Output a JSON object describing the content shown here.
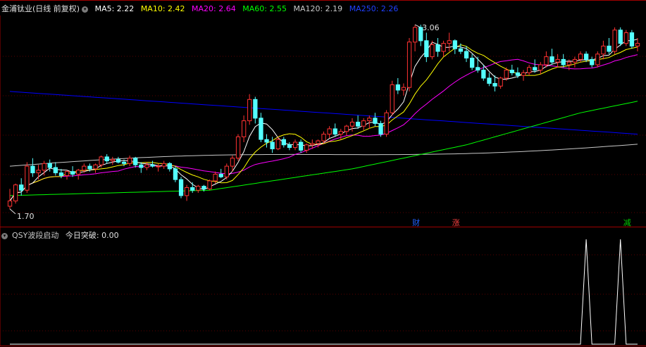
{
  "colors": {
    "up": "#ff3232",
    "down": "#54ffff",
    "ma5": "#ffffff",
    "ma10": "#ffff00",
    "ma20": "#ff00ff",
    "ma60": "#00ff00",
    "ma120": "#c8c8c8",
    "ma250": "#0000ff",
    "grid": "#a00000",
    "tag_cai": "#2060ff",
    "tag_zhang": "#ff4040",
    "tag_jian": "#00cc00"
  },
  "header": {
    "stock": "金浦钛业(日线 前复权)",
    "toggle_icon": "▾",
    "ma": [
      {
        "label": "MA5: 2.22",
        "color": "#ffffff"
      },
      {
        "label": "MA10: 2.42",
        "color": "#ffff00"
      },
      {
        "label": "MA20: 2.64",
        "color": "#ff00ff"
      },
      {
        "label": "MA60: 2.55",
        "color": "#00ff00"
      },
      {
        "label": "MA120: 2.19",
        "color": "#c8c8c8"
      },
      {
        "label": "MA250: 2.26",
        "color": "#0000ff"
      }
    ]
  },
  "indicator_header": {
    "name": "QSY波段启动",
    "value_label": "今日突破: 0.00"
  },
  "markers": {
    "low": "1.70",
    "high": "3.06"
  },
  "tags": [
    {
      "label": "财",
      "index": 71,
      "color_key": "tag_cai"
    },
    {
      "label": "涨",
      "index": 78,
      "color_key": "tag_zhang"
    },
    {
      "label": "减",
      "index": 108,
      "color_key": "tag_jian"
    }
  ],
  "chart_data": {
    "type": "candlestick",
    "price_ylim": [
      1.62,
      3.17
    ],
    "candles": [
      [
        1.72,
        1.85,
        1.7,
        1.76
      ],
      [
        1.76,
        1.89,
        1.74,
        1.88
      ],
      [
        1.88,
        1.93,
        1.8,
        1.84
      ],
      [
        1.84,
        2.05,
        1.82,
        2.02
      ],
      [
        2.02,
        2.08,
        1.94,
        1.97
      ],
      [
        1.97,
        2.03,
        1.92,
        1.99
      ],
      [
        1.99,
        2.06,
        1.95,
        2.04
      ],
      [
        2.04,
        2.07,
        1.98,
        2.01
      ],
      [
        2.01,
        2.05,
        1.95,
        1.97
      ],
      [
        1.97,
        2.0,
        1.93,
        1.95
      ],
      [
        1.95,
        1.99,
        1.92,
        1.98
      ],
      [
        1.98,
        2.02,
        1.94,
        1.96
      ],
      [
        1.96,
        2.0,
        1.92,
        1.99
      ],
      [
        1.99,
        2.04,
        1.97,
        2.02
      ],
      [
        2.02,
        2.04,
        1.98,
        2.0
      ],
      [
        2.0,
        2.04,
        1.97,
        2.03
      ],
      [
        2.03,
        2.1,
        2.01,
        2.09
      ],
      [
        2.09,
        2.11,
        2.04,
        2.06
      ],
      [
        2.06,
        2.09,
        2.03,
        2.07
      ],
      [
        2.07,
        2.09,
        2.04,
        2.05
      ],
      [
        2.05,
        2.07,
        2.02,
        2.04
      ],
      [
        2.04,
        2.1,
        2.02,
        2.08
      ],
      [
        2.08,
        2.09,
        2.01,
        2.03
      ],
      [
        2.03,
        2.05,
        1.97,
        2.01
      ],
      [
        2.01,
        2.05,
        1.99,
        2.03
      ],
      [
        2.03,
        2.06,
        2.01,
        2.02
      ],
      [
        2.02,
        2.04,
        1.98,
        2.02
      ],
      [
        2.02,
        2.06,
        2.0,
        2.04
      ],
      [
        2.04,
        2.05,
        1.98,
        2.0
      ],
      [
        2.0,
        2.02,
        1.9,
        1.92
      ],
      [
        1.92,
        1.94,
        1.78,
        1.8
      ],
      [
        1.8,
        1.88,
        1.76,
        1.86
      ],
      [
        1.86,
        1.9,
        1.82,
        1.84
      ],
      [
        1.84,
        1.88,
        1.82,
        1.87
      ],
      [
        1.87,
        1.88,
        1.83,
        1.85
      ],
      [
        1.85,
        1.92,
        1.84,
        1.91
      ],
      [
        1.91,
        1.98,
        1.89,
        1.96
      ],
      [
        1.96,
        2.0,
        1.93,
        1.94
      ],
      [
        1.94,
        2.04,
        1.92,
        2.02
      ],
      [
        2.02,
        2.1,
        1.98,
        2.08
      ],
      [
        2.08,
        2.26,
        2.06,
        2.24
      ],
      [
        2.24,
        2.4,
        2.2,
        2.36
      ],
      [
        2.36,
        2.56,
        2.33,
        2.52
      ],
      [
        2.52,
        2.54,
        2.34,
        2.38
      ],
      [
        2.38,
        2.42,
        2.2,
        2.22
      ],
      [
        2.22,
        2.26,
        2.16,
        2.2
      ],
      [
        2.2,
        2.24,
        2.12,
        2.15
      ],
      [
        2.15,
        2.24,
        2.14,
        2.22
      ],
      [
        2.22,
        2.24,
        2.16,
        2.18
      ],
      [
        2.18,
        2.2,
        2.14,
        2.16
      ],
      [
        2.16,
        2.22,
        2.14,
        2.2
      ],
      [
        2.2,
        2.22,
        2.12,
        2.14
      ],
      [
        2.14,
        2.19,
        2.12,
        2.18
      ],
      [
        2.18,
        2.22,
        2.15,
        2.19
      ],
      [
        2.19,
        2.22,
        2.16,
        2.21
      ],
      [
        2.21,
        2.28,
        2.19,
        2.26
      ],
      [
        2.26,
        2.32,
        2.23,
        2.3
      ],
      [
        2.3,
        2.34,
        2.24,
        2.26
      ],
      [
        2.26,
        2.3,
        2.22,
        2.28
      ],
      [
        2.28,
        2.33,
        2.25,
        2.32
      ],
      [
        2.32,
        2.38,
        2.28,
        2.35
      ],
      [
        2.35,
        2.4,
        2.3,
        2.32
      ],
      [
        2.32,
        2.38,
        2.29,
        2.36
      ],
      [
        2.36,
        2.4,
        2.3,
        2.38
      ],
      [
        2.38,
        2.42,
        2.32,
        2.34
      ],
      [
        2.34,
        2.36,
        2.24,
        2.26
      ],
      [
        2.26,
        2.44,
        2.24,
        2.42
      ],
      [
        2.42,
        2.66,
        2.4,
        2.63
      ],
      [
        2.63,
        2.68,
        2.56,
        2.59
      ],
      [
        2.59,
        2.64,
        2.55,
        2.61
      ],
      [
        2.61,
        2.98,
        2.58,
        2.95
      ],
      [
        2.95,
        3.08,
        2.88,
        3.06
      ],
      [
        3.06,
        3.08,
        2.92,
        2.96
      ],
      [
        2.96,
        3.02,
        2.8,
        2.84
      ],
      [
        2.84,
        2.96,
        2.82,
        2.93
      ],
      [
        2.93,
        2.98,
        2.84,
        2.88
      ],
      [
        2.88,
        2.96,
        2.84,
        2.94
      ],
      [
        2.94,
        3.02,
        2.88,
        2.96
      ],
      [
        2.96,
        2.97,
        2.86,
        2.9
      ],
      [
        2.9,
        2.94,
        2.86,
        2.88
      ],
      [
        2.88,
        2.92,
        2.8,
        2.83
      ],
      [
        2.83,
        2.86,
        2.74,
        2.76
      ],
      [
        2.76,
        2.84,
        2.72,
        2.74
      ],
      [
        2.74,
        2.78,
        2.66,
        2.68
      ],
      [
        2.68,
        2.72,
        2.62,
        2.64
      ],
      [
        2.64,
        2.7,
        2.58,
        2.62
      ],
      [
        2.62,
        2.69,
        2.6,
        2.68
      ],
      [
        2.68,
        2.76,
        2.66,
        2.74
      ],
      [
        2.74,
        2.78,
        2.7,
        2.72
      ],
      [
        2.72,
        2.76,
        2.68,
        2.7
      ],
      [
        2.7,
        2.74,
        2.66,
        2.72
      ],
      [
        2.72,
        2.78,
        2.7,
        2.76
      ],
      [
        2.76,
        2.82,
        2.72,
        2.74
      ],
      [
        2.74,
        2.8,
        2.71,
        2.78
      ],
      [
        2.78,
        2.88,
        2.76,
        2.84
      ],
      [
        2.84,
        2.9,
        2.78,
        2.8
      ],
      [
        2.8,
        2.86,
        2.76,
        2.82
      ],
      [
        2.82,
        2.86,
        2.76,
        2.78
      ],
      [
        2.78,
        2.82,
        2.74,
        2.8
      ],
      [
        2.8,
        2.84,
        2.76,
        2.82
      ],
      [
        2.82,
        2.88,
        2.8,
        2.86
      ],
      [
        2.86,
        2.88,
        2.8,
        2.82
      ],
      [
        2.82,
        2.84,
        2.76,
        2.78
      ],
      [
        2.78,
        2.88,
        2.76,
        2.86
      ],
      [
        2.86,
        2.96,
        2.82,
        2.92
      ],
      [
        2.92,
        2.98,
        2.86,
        2.88
      ],
      [
        2.88,
        3.06,
        2.86,
        3.04
      ],
      [
        3.04,
        3.06,
        2.92,
        2.94
      ],
      [
        2.94,
        3.04,
        2.92,
        3.02
      ],
      [
        3.02,
        3.04,
        2.9,
        2.92
      ],
      [
        2.92,
        2.98,
        2.88,
        2.94
      ]
    ],
    "ma250_endpoints": [
      2.58,
      2.26
    ],
    "ma120_endpoints": [
      2.02,
      2.19
    ],
    "ma60_points": [
      [
        0,
        1.8
      ],
      [
        35,
        1.84
      ],
      [
        60,
        2.0
      ],
      [
        80,
        2.18
      ],
      [
        100,
        2.42
      ],
      [
        115,
        2.55
      ]
    ],
    "indicator": {
      "ylim": [
        0,
        1
      ],
      "spikes": [
        101,
        107
      ],
      "spike_value": 1.0
    }
  }
}
